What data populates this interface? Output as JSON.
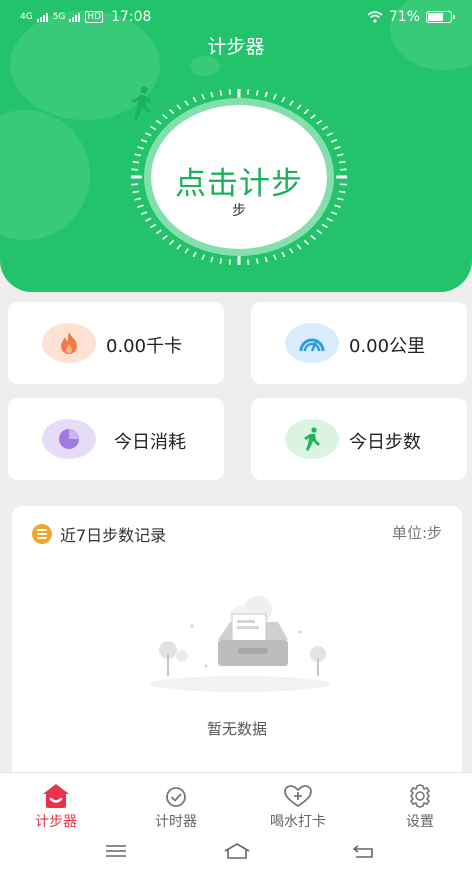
{
  "status_bar": {
    "network_1": "4G",
    "network_2": "5G",
    "hd": "HD",
    "time": "17:08",
    "battery": "71%",
    "battery_level": 0.71
  },
  "header": {
    "title": "计步器",
    "cta": "点击计步",
    "unit": "步"
  },
  "stats": {
    "calories": "0.00千卡",
    "distance": "0.00公里",
    "today_consumption": "今日消耗",
    "today_steps": "今日步数"
  },
  "record": {
    "title": "近7日步数记录",
    "unit": "单位:步",
    "empty": "暂无数据"
  },
  "tabs": [
    {
      "label": "计步器",
      "icon": "house-icon",
      "active": true
    },
    {
      "label": "计时器",
      "icon": "check-circle-icon",
      "active": false
    },
    {
      "label": "喝水打卡",
      "icon": "heart-plus-icon",
      "active": false
    },
    {
      "label": "设置",
      "icon": "gear-icon",
      "active": false
    }
  ],
  "colors": {
    "primary_green": "#22c36a",
    "active_red": "#e8334a",
    "record_badge": "#f0a62a"
  }
}
